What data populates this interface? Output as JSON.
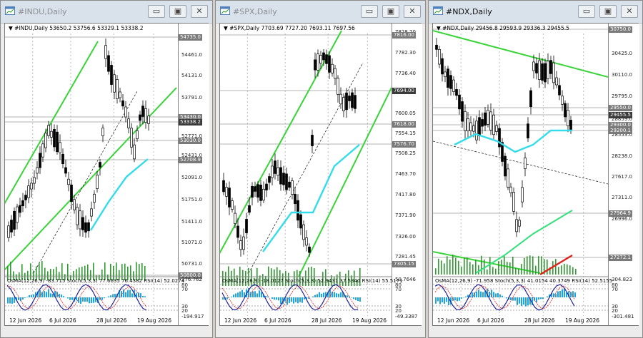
{
  "windows": [
    {
      "title": "#INDU,Daily",
      "active": false,
      "ohlc": "▼ #INDU,Daily  53650.2  53756.6  53329.1  53338.2",
      "price_labels": [
        "54461.0",
        "54131.0",
        "53791.0",
        "53111.0",
        "52771.0",
        "52431.0",
        "52091.0",
        "51751.0",
        "51411.0",
        "51071.0",
        "50731.0"
      ],
      "price_tags": [
        "54735.0",
        "53430.0",
        "53338.2",
        "53030.0",
        "52708.9",
        "50800.0"
      ],
      "osc_text": "OsMA(12,26,9) -83.715  Stoch(5,3,3) 77.6635 76.4382  RSI(14) 52.0274",
      "osc_right": [
        "276.762",
        "80",
        "70",
        "30",
        "20",
        "-194.917"
      ],
      "dates": [
        "12 Jun 2026",
        "6 Jul 2026",
        "28 Jul 2026",
        "19 Aug 2026"
      ]
    },
    {
      "title": "#SPX,Daily",
      "active": false,
      "ohlc": "▼ #SPX,Daily  7703.69  7727.20  7693.11  7697.56",
      "price_labels": [
        "7828.20",
        "7782.30",
        "7736.40",
        "7645.95",
        "7600.05",
        "7554.15",
        "7508.25",
        "7463.70",
        "7417.80",
        "7371.90",
        "7326.00",
        "7281.45"
      ],
      "price_tags": [
        "7816.00",
        "7694.00",
        "7618.00",
        "7576.70",
        "7305.15"
      ],
      "osc_text": "OsMA(12,26,9) -18.0127  Stoch(5,3,3) 52.9431 37.5340  RSI(14) 55.5171",
      "osc_right": [
        "50.7646",
        "80",
        "70",
        "30",
        "20",
        "-49.3387"
      ],
      "dates": [
        "12 Jun 2026",
        "6 Jul 2026",
        "28 Jul 2026",
        "19 Aug 2026"
      ]
    },
    {
      "title": "#NDX,Daily",
      "active": true,
      "ohlc": "▼ #NDX,Daily  29456.8  29593.9  29336.3  29455.5",
      "price_labels": [
        "30425.0",
        "30110.0",
        "29795.0",
        "28859.0",
        "28553.0",
        "28238.0",
        "27617.0",
        "27311.0",
        "26996.0"
      ],
      "price_tags": [
        "30750.0",
        "29550.0",
        "29455.5",
        "29300.0",
        "29200.1",
        "27964.9",
        "27272.1"
      ],
      "osc_text": "OsMA(12,26,9) -71.958  Stoch(5,3,3) 41.0154 40.3749  RSI(14) 52.5155",
      "osc_right": [
        "304.823",
        "80",
        "70",
        "30",
        "20",
        "-301.481"
      ],
      "dates": [
        "12 Jun 2026",
        "6 Jul 2026",
        "28 Jul 2026",
        "19 Aug 2026"
      ]
    }
  ]
}
